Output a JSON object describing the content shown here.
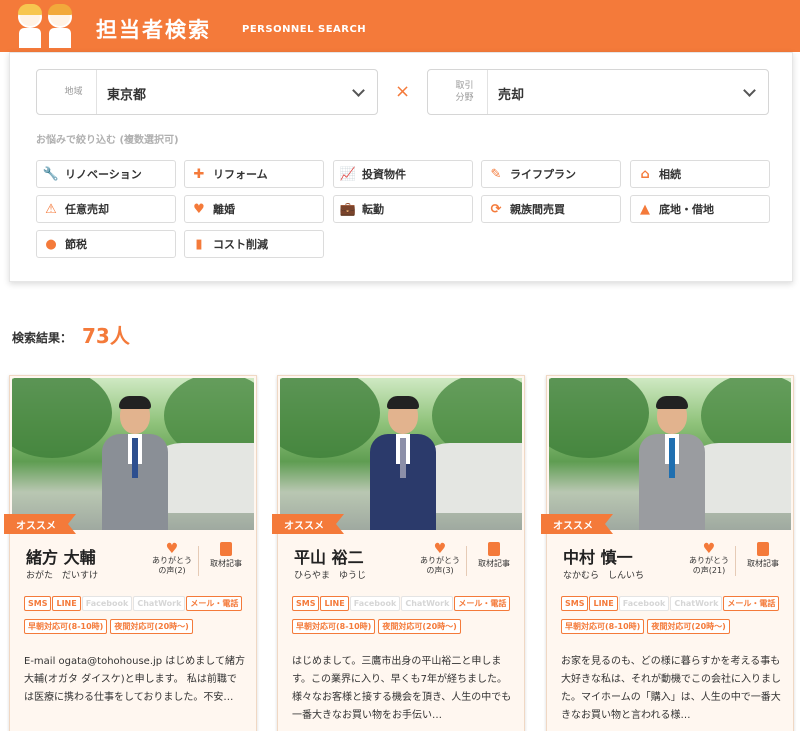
{
  "header": {
    "title": "担当者検索",
    "subtitle": "PERSONNEL SEARCH"
  },
  "search": {
    "area_label": "地域",
    "area_value": "東京都",
    "field_label": "取引\n分野",
    "field_value": "売却",
    "times": "×",
    "filter_label": "お悩みで絞り込む (複数選択可)",
    "tags": [
      {
        "label": "リノベーション",
        "icon": "wrench-icon"
      },
      {
        "label": "リフォーム",
        "icon": "plus-icon"
      },
      {
        "label": "投資物件",
        "icon": "chart-line-icon"
      },
      {
        "label": "ライフプラン",
        "icon": "pen-icon"
      },
      {
        "label": "相続",
        "icon": "house-icon"
      },
      {
        "label": "任意売却",
        "icon": "house-alert-icon"
      },
      {
        "label": "離婚",
        "icon": "broken-heart-icon"
      },
      {
        "label": "転勤",
        "icon": "briefcase-icon"
      },
      {
        "label": "親族間売買",
        "icon": "refresh-icon"
      },
      {
        "label": "底地・借地",
        "icon": "land-icon"
      },
      {
        "label": "節税",
        "icon": "money-bag-icon"
      },
      {
        "label": "コスト削減",
        "icon": "bar-chart-icon"
      }
    ]
  },
  "result": {
    "label": "検索結果：",
    "count": "73人"
  },
  "cards": [
    {
      "ribbon": "オススメ",
      "name": "緒方 大輔",
      "kana": "おがた　だいすけ",
      "thanks": "ありがとう\nの声(2)",
      "article": "取材記事",
      "badges": [
        "SMS",
        "LINE",
        "Facebook",
        "ChatWork",
        "メール・電話"
      ],
      "badges_on": [
        true,
        true,
        false,
        false,
        true
      ],
      "hours": [
        "早朝対応可(8-10時)",
        "夜間対応可(20時〜)"
      ],
      "intro": "E-mail ogata@tohohouse.jp はじめまして緒方 大輔(オガタ ダイスケ)と申します。 私は前職では医療に携わる仕事をしておりました。不安…",
      "suit_color": "#8a8f96",
      "tie_color": "#2d4f8f"
    },
    {
      "ribbon": "オススメ",
      "name": "平山 裕二",
      "kana": "ひらやま　ゆうじ",
      "thanks": "ありがとう\nの声(3)",
      "article": "取材記事",
      "badges": [
        "SMS",
        "LINE",
        "Facebook",
        "ChatWork",
        "メール・電話"
      ],
      "badges_on": [
        true,
        true,
        false,
        false,
        true
      ],
      "hours": [
        "早朝対応可(8-10時)",
        "夜間対応可(20時〜)"
      ],
      "intro": "はじめまして。三鷹市出身の平山裕二と申します。この業界に入り、早くも7年が経ちました。様々なお客様と接する機会を頂き、人生の中でも一番大きなお買い物をお手伝い…",
      "suit_color": "#2b3a6b",
      "tie_color": "#8c8fa8"
    },
    {
      "ribbon": "オススメ",
      "name": "中村 慎一",
      "kana": "なかむら　しんいち",
      "thanks": "ありがとう\nの声(21)",
      "article": "取材記事",
      "badges": [
        "SMS",
        "LINE",
        "Facebook",
        "ChatWork",
        "メール・電話"
      ],
      "badges_on": [
        true,
        true,
        false,
        false,
        true
      ],
      "hours": [
        "早朝対応可(8-10時)",
        "夜間対応可(20時〜)"
      ],
      "intro": "お家を見るのも、どの様に暮らすかを考える事も大好きな私は、それが動機でこの会社に入りました。マイホームの「購入」は、人生の中で一番大きなお買い物と言われる様…",
      "suit_color": "#9a9ca0",
      "tie_color": "#1f6fb0"
    }
  ]
}
